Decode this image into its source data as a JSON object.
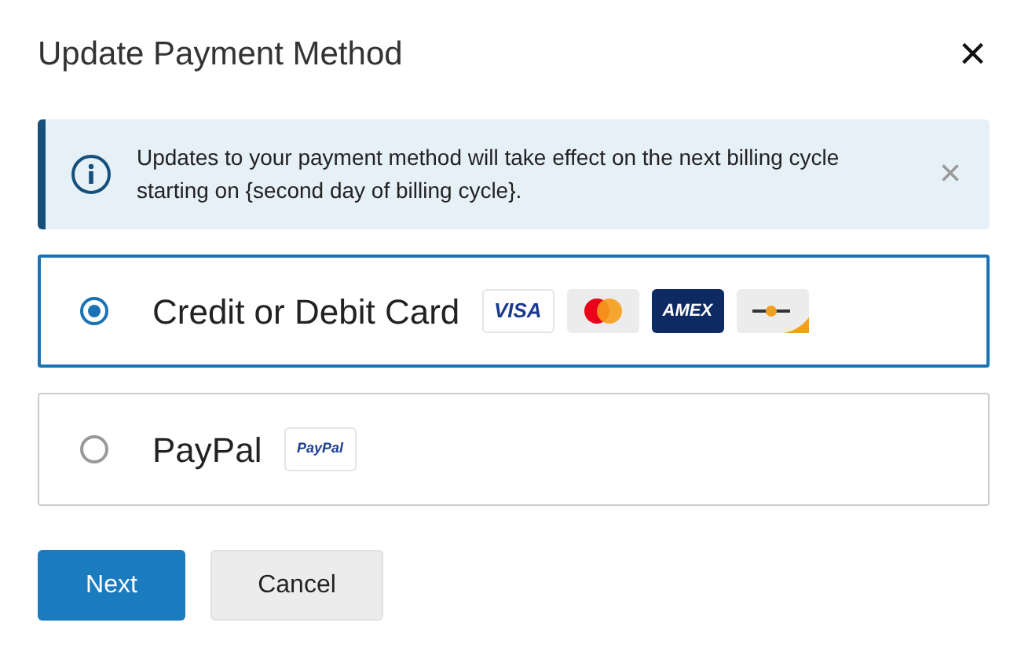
{
  "dialog": {
    "title": "Update Payment Method",
    "close": "×"
  },
  "alert": {
    "text": "Updates to your payment method will take effect on the next billing cycle starting on {second day of billing cycle}.",
    "dismiss": "×"
  },
  "options": [
    {
      "label": "Credit or Debit Card",
      "selected": true,
      "logos": [
        {
          "kind": "visa",
          "text": "VISA"
        },
        {
          "kind": "mastercard"
        },
        {
          "kind": "amex",
          "text": "AMEX"
        },
        {
          "kind": "generic"
        }
      ]
    },
    {
      "label": "PayPal",
      "selected": false,
      "logos": [
        {
          "kind": "paypal",
          "text": "PayPal"
        }
      ]
    }
  ],
  "buttons": [
    {
      "label": "Next",
      "kind": "primary"
    },
    {
      "label": "Cancel",
      "kind": "secondary"
    }
  ]
}
